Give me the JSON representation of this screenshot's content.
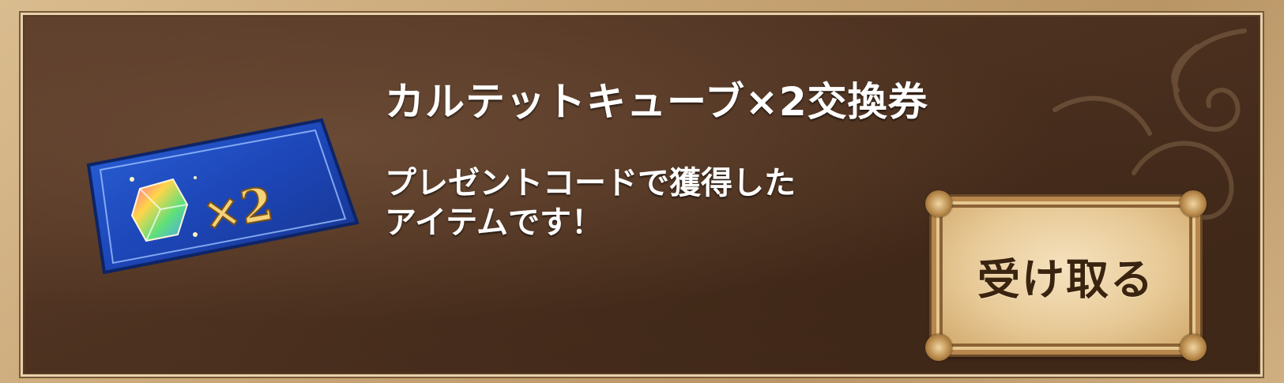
{
  "item": {
    "title": "カルテットキューブ×2交換券",
    "description_lines": [
      "プレゼントコードで獲得した",
      "アイテムです！"
    ],
    "ticket_count_label": "×2"
  },
  "button": {
    "receive_label": "受け取る"
  },
  "colors": {
    "panel_bg": "#4d3120",
    "frame": "#c9a878",
    "text": "#ffffff",
    "ticket_blue": "#1f4fc4",
    "button_bg": "#e7c996",
    "button_text": "#3a2410"
  },
  "icons": {
    "ticket": "exchange-ticket-icon",
    "cube": "quartet-cube-icon"
  }
}
